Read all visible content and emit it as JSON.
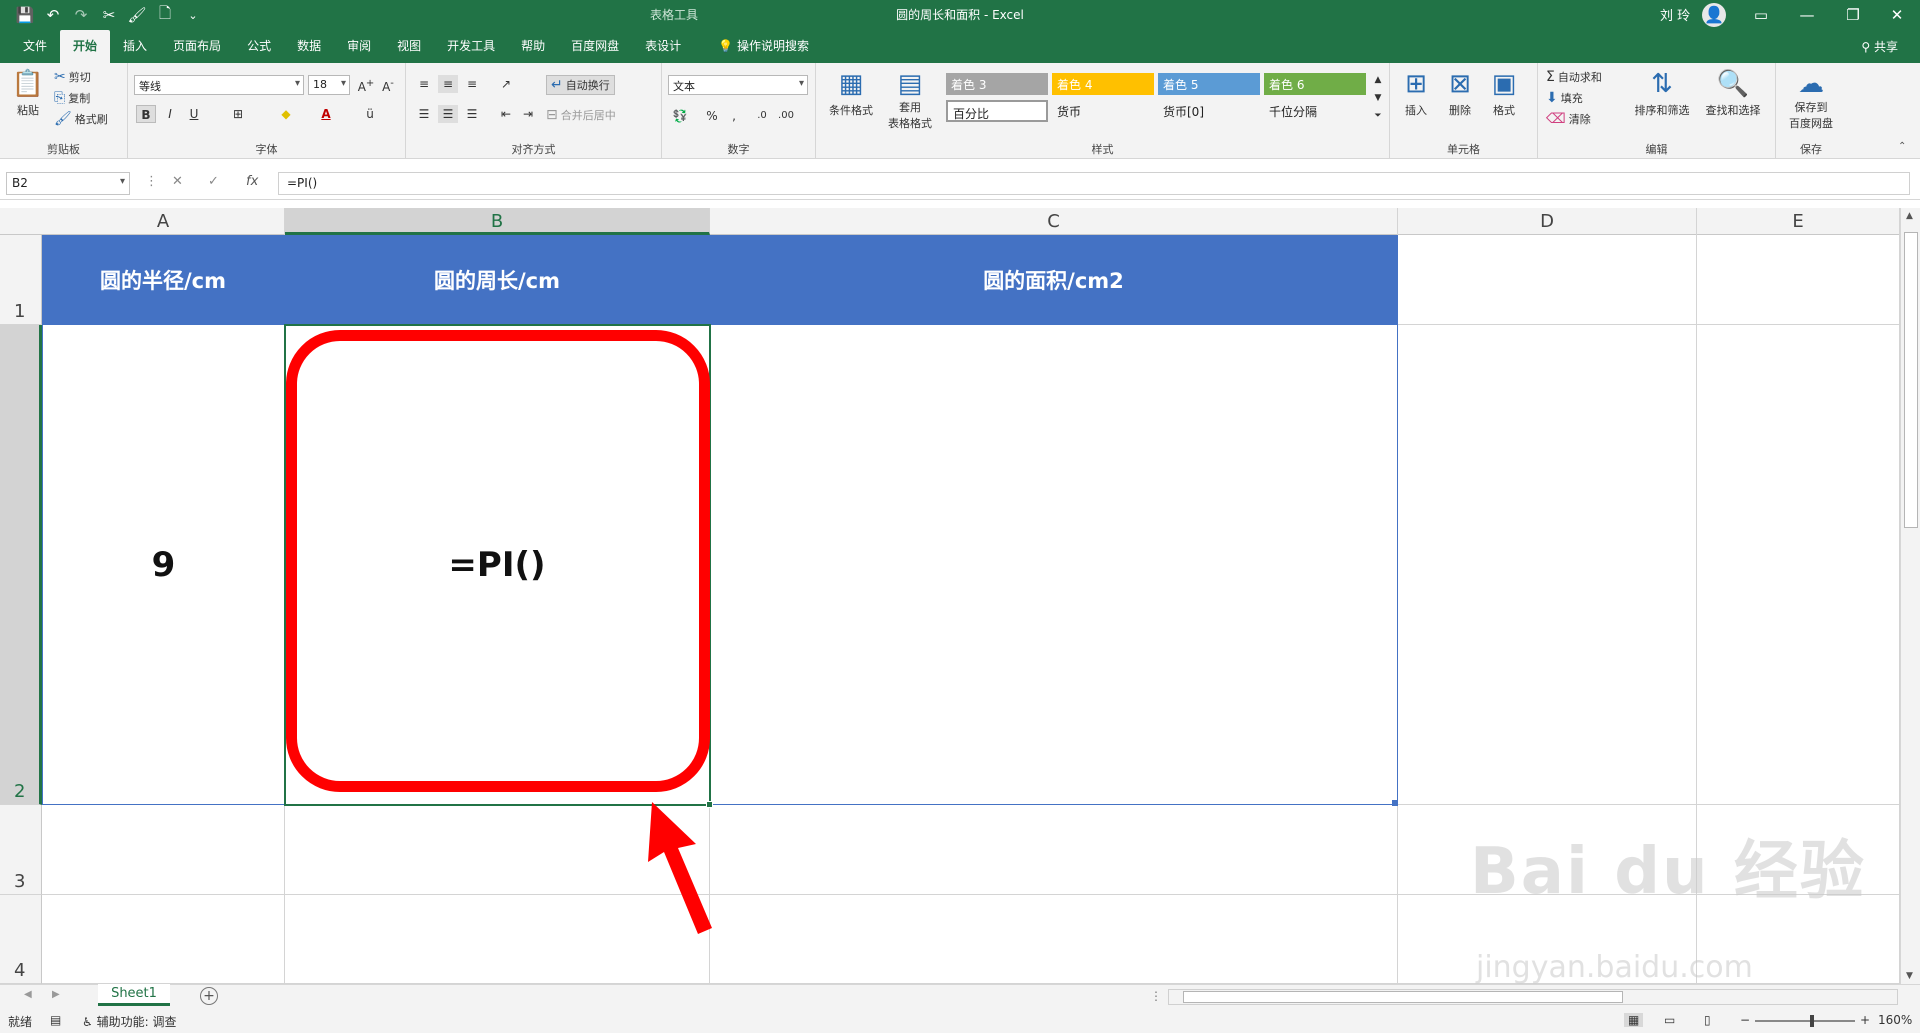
{
  "titlebar": {
    "context_tab": "表格工具",
    "title": "圆的周长和面积  -  Excel",
    "user": "刘 玲",
    "qat_icons": [
      "save-icon",
      "undo-icon",
      "redo-icon",
      "cut-icon",
      "brush-icon",
      "new-file-icon",
      "customize-icon"
    ]
  },
  "tabs": [
    "文件",
    "开始",
    "插入",
    "页面布局",
    "公式",
    "数据",
    "审阅",
    "视图",
    "开发工具",
    "帮助",
    "百度网盘",
    "表设计"
  ],
  "active_tab": "开始",
  "tell_me": "操作说明搜索",
  "share": "共享",
  "ribbon": {
    "clipboard": {
      "label": "剪贴板",
      "paste": "粘贴",
      "cut": "剪切",
      "copy": "复制",
      "format_painter": "格式刷"
    },
    "font": {
      "label": "字体",
      "font_name": "等线",
      "font_size": "18",
      "bold": "B",
      "italic": "I",
      "underline": "U"
    },
    "alignment": {
      "label": "对齐方式",
      "wrap": "自动换行",
      "merge": "合并后居中"
    },
    "number": {
      "label": "数字",
      "format": "文本",
      "percent": "%",
      "comma": ","
    },
    "styles": {
      "label": "样式",
      "conditional": "条件格式",
      "table_format_1": "套用",
      "table_format_2": "表格格式",
      "cells": [
        {
          "name": "着色 3",
          "color": "#a5a5a5"
        },
        {
          "name": "着色 4",
          "color": "#ffc000"
        },
        {
          "name": "着色 5",
          "color": "#5b9bd5"
        },
        {
          "name": "着色 6",
          "color": "#70ad47"
        },
        {
          "name": "百分比",
          "color": "#ffffff"
        },
        {
          "name": "货币",
          "color": "#ffffff"
        },
        {
          "name": "货币[0]",
          "color": "#ffffff"
        },
        {
          "name": "千位分隔",
          "color": "#ffffff"
        }
      ]
    },
    "cells_group": {
      "label": "单元格",
      "insert": "插入",
      "delete": "删除",
      "format": "格式"
    },
    "editing": {
      "label": "编辑",
      "autosum": "自动求和",
      "fill": "填充",
      "clear": "清除",
      "sort": "排序和筛选",
      "find": "查找和选择"
    },
    "save": {
      "label": "保存",
      "save_to_1": "保存到",
      "save_to_2": "百度网盘"
    }
  },
  "formula_bar": {
    "name_box": "B2",
    "formula": "=PI()"
  },
  "columns": [
    "A",
    "B",
    "C",
    "D",
    "E"
  ],
  "rows": [
    "1",
    "2",
    "3",
    "4"
  ],
  "table": {
    "header": [
      "圆的半径/cm",
      "圆的周长/cm",
      "圆的面积/cm2"
    ],
    "row2": [
      "9",
      "=PI()",
      ""
    ]
  },
  "sheets": [
    "Sheet1"
  ],
  "status": {
    "ready": "就绪",
    "accessibility": "辅助功能: 调查",
    "zoom": "160%"
  },
  "colors": {
    "brand": "#217346",
    "header_fill": "#4472c4",
    "annotation": "#ff0000"
  }
}
